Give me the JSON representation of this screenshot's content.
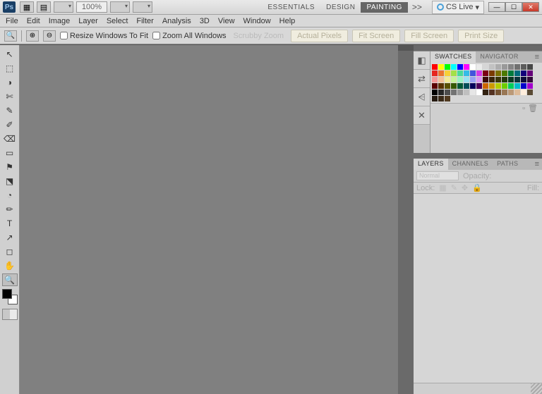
{
  "titlebar": {
    "logo": "Ps",
    "zoom": "100%",
    "workspaces": [
      "ESSENTIALS",
      "DESIGN",
      "PAINTING"
    ],
    "active_workspace": 2,
    "more": ">>",
    "cslive": "CS Live"
  },
  "menu": [
    "File",
    "Edit",
    "Image",
    "Layer",
    "Select",
    "Filter",
    "Analysis",
    "3D",
    "View",
    "Window",
    "Help"
  ],
  "options": {
    "resize_label": "Resize Windows To Fit",
    "zoom_all_label": "Zoom All Windows",
    "scrubby": "Scrubby Zoom",
    "buttons": [
      "Actual Pixels",
      "Fit Screen",
      "Fill Screen",
      "Print Size"
    ]
  },
  "tools": [
    "↖",
    "⬚",
    "◑",
    "✄",
    "✎",
    "✐",
    "⌫",
    "▭",
    "⚑",
    "⬔",
    "◔",
    "✏",
    "T",
    "↗",
    "◻",
    "✋",
    "🔍"
  ],
  "selected_tool": 16,
  "swatches_panel": {
    "tabs": [
      "SWATCHES",
      "NAVIGATOR"
    ],
    "active": 0,
    "side_icons": [
      "◧",
      "⇄",
      "⩤",
      "✕"
    ],
    "colors": [
      "#ff0000",
      "#ffff00",
      "#00ff00",
      "#00ffff",
      "#0000ff",
      "#ff00ff",
      "#ffffff",
      "#ebebeb",
      "#d6d6d6",
      "#c2c2c2",
      "#adadad",
      "#999999",
      "#858585",
      "#707070",
      "#5c5c5c",
      "#474747",
      "#e6261f",
      "#eb7532",
      "#f7d038",
      "#a3e048",
      "#49da9a",
      "#34bbe6",
      "#4355db",
      "#d23be7",
      "#7a0015",
      "#7a3b00",
      "#7a7000",
      "#4c7a00",
      "#007a3d",
      "#006b7a",
      "#12007a",
      "#66007a",
      "#f29999",
      "#f2c199",
      "#f2ea99",
      "#c6f299",
      "#99f2c2",
      "#99e2f2",
      "#99a3f2",
      "#df99f2",
      "#3a0b0b",
      "#3a250b",
      "#3a360b",
      "#233a0b",
      "#0b3a24",
      "#0b343a",
      "#0e0b3a",
      "#320b3a",
      "#590000",
      "#593200",
      "#595100",
      "#355900",
      "#005936",
      "#004f59",
      "#060059",
      "#4c0059",
      "#cc6600",
      "#cc9a00",
      "#b3cc00",
      "#6ccc00",
      "#00cc5a",
      "#00bacc",
      "#0600cc",
      "#a300cc",
      "#000000",
      "#262626",
      "#4d4d4d",
      "#737373",
      "#999999",
      "#bfbfbf",
      "#e6e6e6",
      "#ffffff",
      "#332211",
      "#553322",
      "#775533",
      "#997755",
      "#bb9977",
      "#ddbb99",
      "#ffeedd",
      "#5a4a34",
      "#241a10",
      "#3a2a18",
      "#503a20"
    ]
  },
  "layers_panel": {
    "tabs": [
      "LAYERS",
      "CHANNELS",
      "PATHS"
    ],
    "active": 0,
    "blend_mode": "Normal",
    "opacity_label": "Opacity:",
    "lock_label": "Lock:",
    "fill_label": "Fill:",
    "lock_icons": [
      "▦",
      "✎",
      "✥",
      "🔒"
    ]
  }
}
